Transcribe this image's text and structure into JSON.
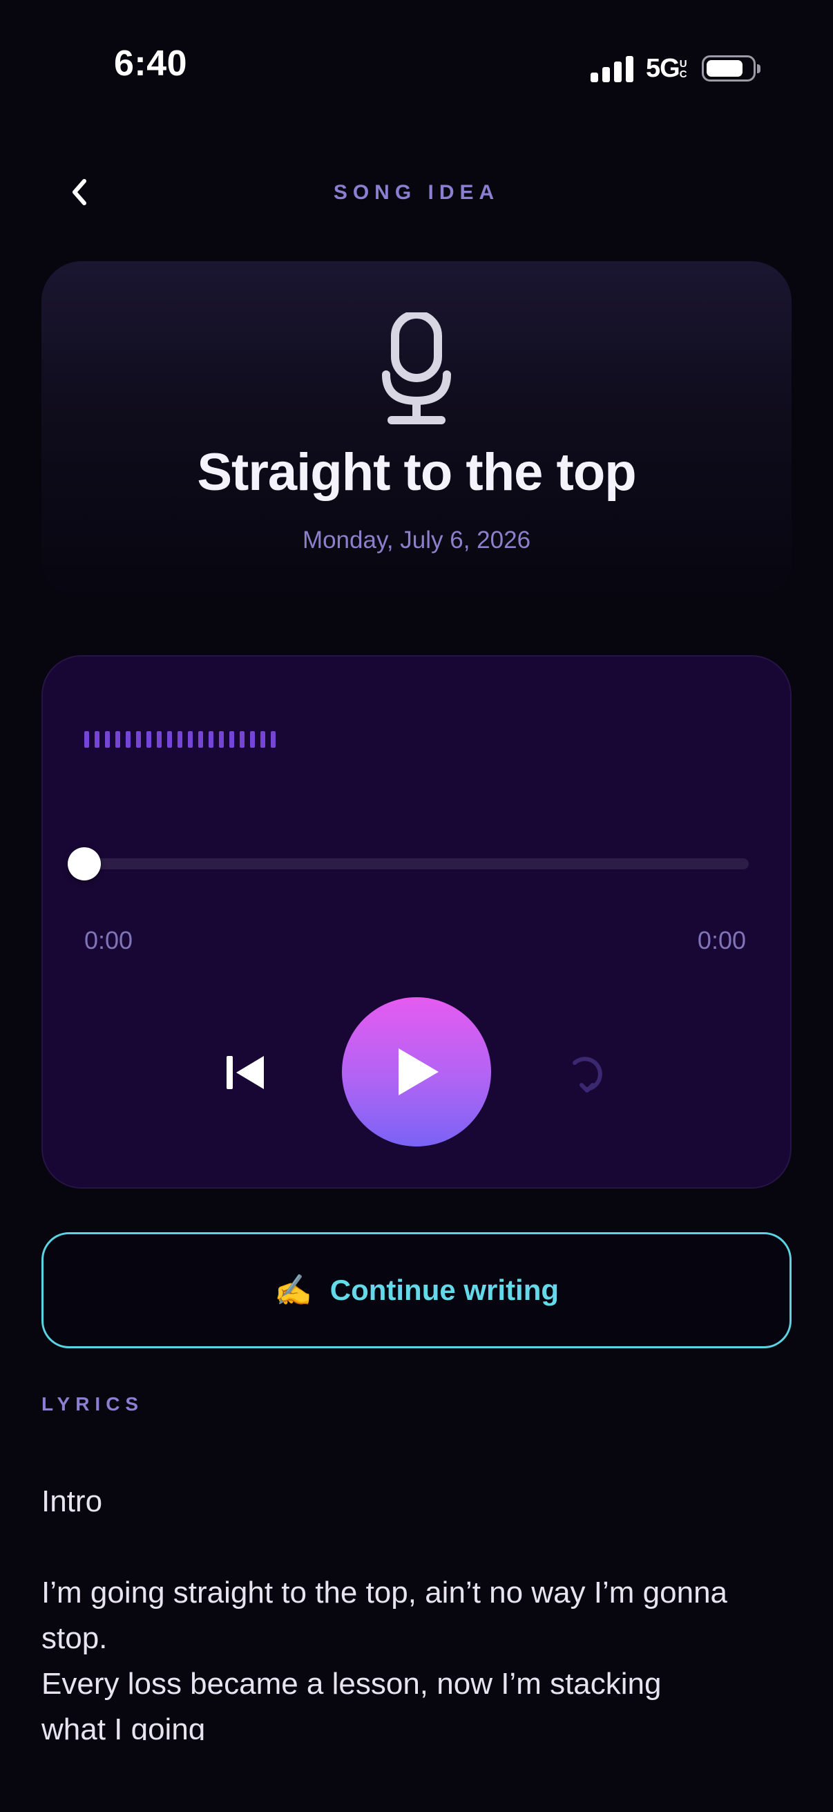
{
  "status_bar": {
    "time": "6:40",
    "network": "5G",
    "network_suffix": "UC",
    "icons": [
      "signal-icon",
      "battery-icon"
    ]
  },
  "header": {
    "back_icon": "chevron-left-icon",
    "title": "SONG IDEA"
  },
  "song": {
    "icon": "microphone-icon",
    "title": "Straight to the top",
    "date": "Monday, July 6, 2026"
  },
  "player": {
    "progress": 0,
    "elapsed": "0:00",
    "duration": "0:00",
    "waveform_bar_count": 19,
    "controls": {
      "previous_icon": "skip-previous-icon",
      "play_icon": "play-icon",
      "repeat_icon": "repeat-icon"
    }
  },
  "continue_button": {
    "emoji": "✍️",
    "label": "Continue writing"
  },
  "lyrics": {
    "header": "LYRICS",
    "section": "Intro",
    "line1": "I’m going straight to the top, ain’t no way I’m gonna stop.",
    "line2": "Every loss became a lesson, now I’m stacking",
    "line3": "what I going"
  },
  "colors": {
    "background": "#07060f",
    "accent_purple": "#8a7fd0",
    "player_card": "#180734",
    "play_gradient_top": "#e55bf0",
    "play_gradient_bottom": "#7a63f5",
    "continue_accent": "#5cd3e3"
  }
}
